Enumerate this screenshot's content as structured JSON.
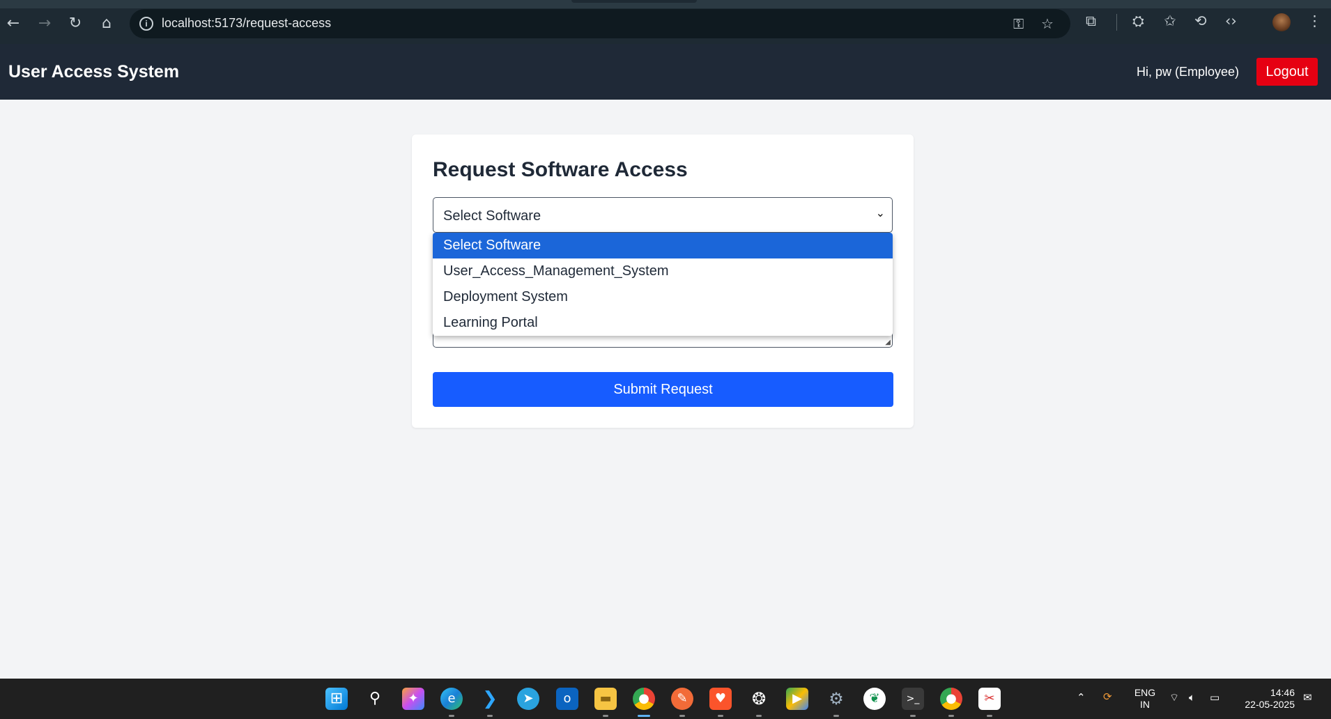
{
  "browser": {
    "url": "localhost:5173/request-access"
  },
  "header": {
    "title": "User Access System",
    "greeting": "Hi, pw (Employee)",
    "logout_label": "Logout"
  },
  "form": {
    "title": "Request Software Access",
    "select_value": "Select Software",
    "options": [
      "Select Software",
      "User_Access_Management_System",
      "Deployment System",
      "Learning Portal"
    ],
    "submit_label": "Submit Request"
  },
  "taskbar": {
    "language": "ENG",
    "region": "IN",
    "time": "14:46",
    "date": "22-05-2025"
  },
  "colors": {
    "header_bg": "#1f2937",
    "logout_red": "#e60012",
    "submit_blue": "#175cff",
    "option_highlight": "#1b66d9"
  }
}
